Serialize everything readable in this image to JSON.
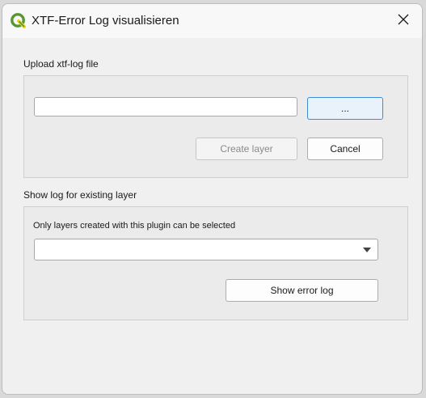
{
  "window": {
    "title": "XTF-Error Log visualisieren",
    "app_icon": "qgis-icon",
    "close_icon": "close-icon"
  },
  "upload_section": {
    "label": "Upload xtf-log file",
    "file_path_value": "",
    "browse_label": "...",
    "create_layer_label": "Create layer",
    "cancel_label": "Cancel"
  },
  "existing_section": {
    "label": "Show log for existing layer",
    "hint": "Only layers created with this plugin can be selected",
    "layer_select_value": "",
    "show_error_log_label": "Show error log"
  },
  "colors": {
    "qgis_green": "#589632",
    "qgis_yellow": "#ee7913",
    "focus_blue": "#3b8ed6"
  }
}
